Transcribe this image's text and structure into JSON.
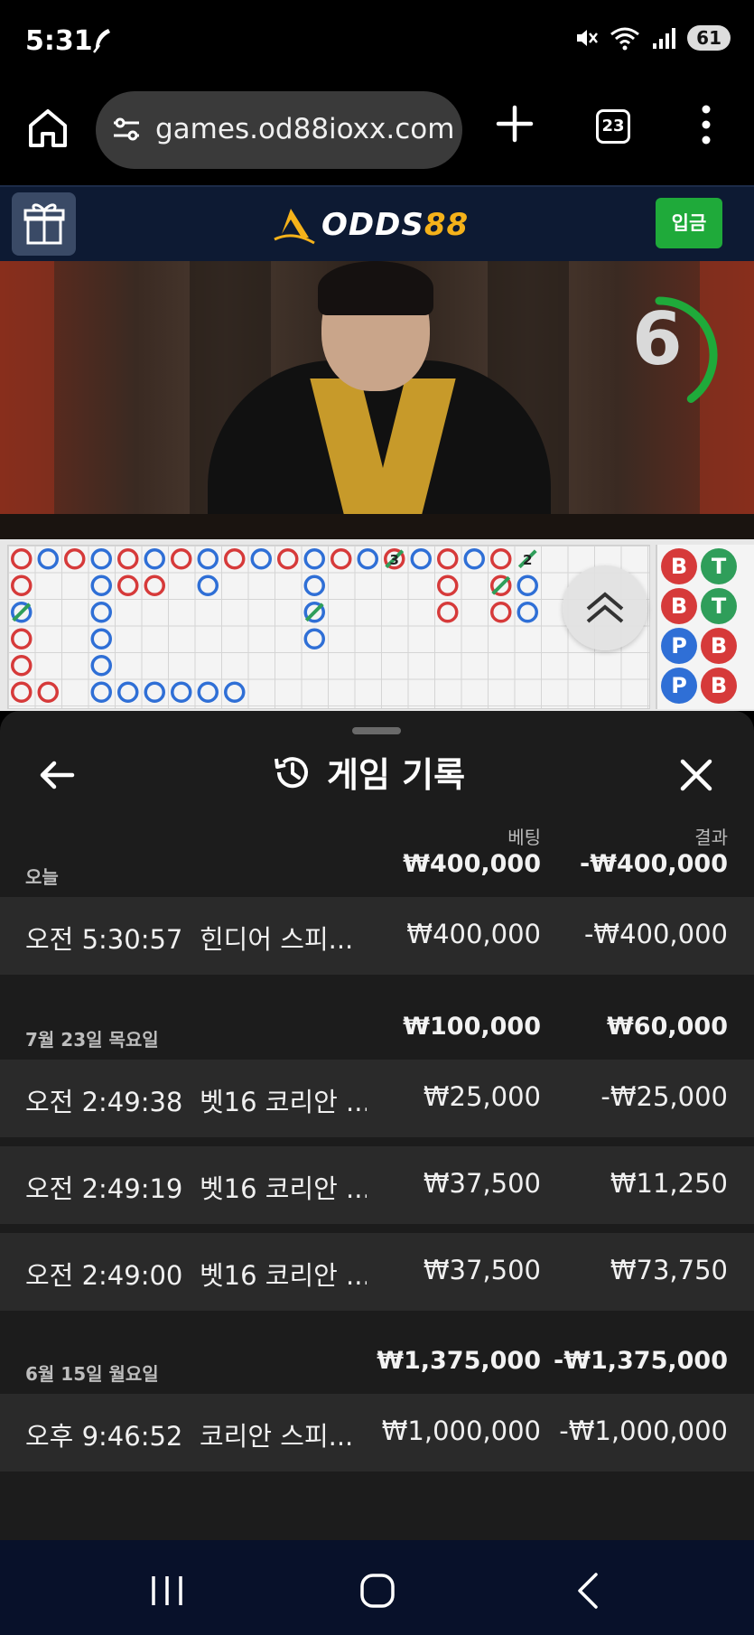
{
  "status_bar": {
    "time": "5:31",
    "battery": "61",
    "icons": [
      "feather-icon",
      "mute-icon",
      "wifi-icon",
      "signal-icon",
      "battery-icon"
    ]
  },
  "browser": {
    "url": "games.od88ioxx.com",
    "tab_count": "23",
    "icons": [
      "home-icon",
      "site-settings-icon",
      "plus-icon",
      "tab-switcher-icon",
      "more-vert-icon"
    ]
  },
  "site": {
    "logo_prefix": "ODDS",
    "logo_suffix": "88",
    "deposit_label": "입금",
    "brand_color": "#f5b21a",
    "deposit_color": "#1faa3a"
  },
  "video": {
    "countdown": "6",
    "countdown_fraction": 0.4
  },
  "bead_road": {
    "rows": [
      [
        "B",
        "T"
      ],
      [
        "B",
        "T"
      ],
      [
        "P",
        "B"
      ],
      [
        "P",
        "B"
      ]
    ],
    "colors": {
      "B": "#d63a3a",
      "P": "#2f6fd6",
      "T": "#2f9e5a"
    }
  },
  "big_road": {
    "badges": [
      "3",
      "2"
    ]
  },
  "history": {
    "title": "게임 기록",
    "col_bet": "베팅",
    "col_result": "결과",
    "groups": [
      {
        "date": "오늘",
        "bet": "₩400,000",
        "result": "-₩400,000",
        "records": [
          {
            "time": "오전 5:30:57",
            "game": "힌디어 스피...",
            "bet": "₩400,000",
            "result": "-₩400,000"
          }
        ]
      },
      {
        "date": "7월 23일 목요일",
        "bet": "₩100,000",
        "result": "₩60,000",
        "records": [
          {
            "time": "오전 2:49:38",
            "game": "벳16 코리안 ...",
            "bet": "₩25,000",
            "result": "-₩25,000"
          },
          {
            "time": "오전 2:49:19",
            "game": "벳16 코리안 ...",
            "bet": "₩37,500",
            "result": "₩11,250"
          },
          {
            "time": "오전 2:49:00",
            "game": "벳16 코리안 ...",
            "bet": "₩37,500",
            "result": "₩73,750"
          }
        ]
      },
      {
        "date": "6월 15일 월요일",
        "bet": "₩1,375,000",
        "result": "-₩1,375,000",
        "records": [
          {
            "time": "오후 9:46:52",
            "game": "코리안 스피...",
            "bet": "₩1,000,000",
            "result": "-₩1,000,000"
          }
        ]
      }
    ]
  },
  "nav": {
    "icons": [
      "recent-apps-icon",
      "home-nav-icon",
      "back-nav-icon"
    ]
  }
}
